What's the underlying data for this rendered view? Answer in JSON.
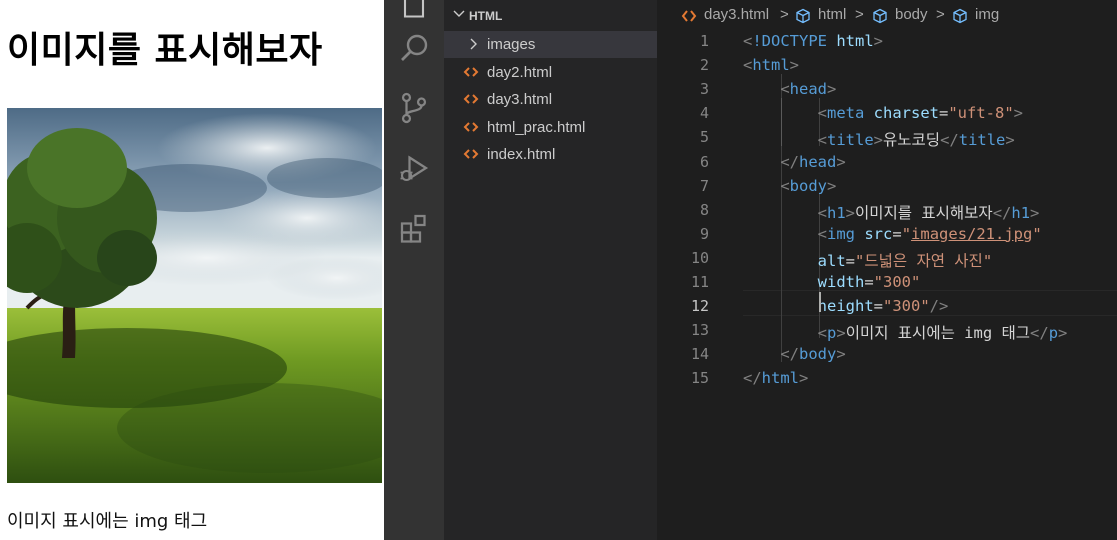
{
  "preview": {
    "heading": "이미지를 표시해보자",
    "paragraph": "이미지 표시에는 img 태그"
  },
  "explorer": {
    "folder": "HTML",
    "items": [
      {
        "label": "images",
        "type": "folder"
      },
      {
        "label": "day2.html",
        "type": "html"
      },
      {
        "label": "day3.html",
        "type": "html"
      },
      {
        "label": "html_prac.html",
        "type": "html"
      },
      {
        "label": "index.html",
        "type": "html"
      }
    ]
  },
  "breadcrumb": {
    "file": "day3.html",
    "path": [
      "html",
      "body",
      "img"
    ],
    "separator": ">"
  },
  "editor": {
    "active_line": 12,
    "line_numbers": [
      "1",
      "2",
      "3",
      "4",
      "5",
      "6",
      "7",
      "8",
      "9",
      "10",
      "11",
      "12",
      "13",
      "14",
      "15"
    ],
    "lines": [
      [
        [
          "tk-punc",
          "<"
        ],
        [
          "tk-doctype",
          "!DOCTYPE"
        ],
        [
          "tk-text",
          " "
        ],
        [
          "tk-attr",
          "html"
        ],
        [
          "tk-punc",
          ">"
        ]
      ],
      [
        [
          "tk-punc",
          "<"
        ],
        [
          "tk-tag",
          "html"
        ],
        [
          "tk-punc",
          ">"
        ]
      ],
      [
        [
          "tk-text",
          "    "
        ],
        [
          "tk-punc",
          "<"
        ],
        [
          "tk-tag",
          "head"
        ],
        [
          "tk-punc",
          ">"
        ]
      ],
      [
        [
          "tk-text",
          "        "
        ],
        [
          "tk-punc",
          "<"
        ],
        [
          "tk-tag",
          "meta"
        ],
        [
          "tk-text",
          " "
        ],
        [
          "tk-attr",
          "charset"
        ],
        [
          "tk-text",
          "="
        ],
        [
          "tk-str",
          "\"uft-8\""
        ],
        [
          "tk-punc",
          ">"
        ]
      ],
      [
        [
          "tk-text",
          "        "
        ],
        [
          "tk-punc",
          "<"
        ],
        [
          "tk-tag",
          "title"
        ],
        [
          "tk-punc",
          ">"
        ],
        [
          "tk-text",
          "유노코딩"
        ],
        [
          "tk-punc",
          "</"
        ],
        [
          "tk-tag",
          "title"
        ],
        [
          "tk-punc",
          ">"
        ]
      ],
      [
        [
          "tk-text",
          "    "
        ],
        [
          "tk-punc",
          "</"
        ],
        [
          "tk-tag",
          "head"
        ],
        [
          "tk-punc",
          ">"
        ]
      ],
      [
        [
          "tk-text",
          "    "
        ],
        [
          "tk-punc",
          "<"
        ],
        [
          "tk-tag",
          "body"
        ],
        [
          "tk-punc",
          ">"
        ]
      ],
      [
        [
          "tk-text",
          "        "
        ],
        [
          "tk-punc",
          "<"
        ],
        [
          "tk-tag",
          "h1"
        ],
        [
          "tk-punc",
          ">"
        ],
        [
          "tk-text",
          "이미지를 표시해보자"
        ],
        [
          "tk-punc",
          "</"
        ],
        [
          "tk-tag",
          "h1"
        ],
        [
          "tk-punc",
          ">"
        ]
      ],
      [
        [
          "tk-text",
          "        "
        ],
        [
          "tk-punc",
          "<"
        ],
        [
          "tk-tag",
          "img"
        ],
        [
          "tk-text",
          " "
        ],
        [
          "tk-attr",
          "src"
        ],
        [
          "tk-text",
          "="
        ],
        [
          "tk-str",
          "\""
        ],
        [
          "tk-link",
          "images/21.jpg"
        ],
        [
          "tk-str",
          "\""
        ]
      ],
      [
        [
          "tk-text",
          "        "
        ],
        [
          "tk-attr",
          "alt"
        ],
        [
          "tk-text",
          "="
        ],
        [
          "tk-str",
          "\"드넓은 자연 사진\""
        ]
      ],
      [
        [
          "tk-text",
          "        "
        ],
        [
          "tk-attr",
          "width"
        ],
        [
          "tk-text",
          "="
        ],
        [
          "tk-str",
          "\"300\""
        ]
      ],
      [
        [
          "tk-text",
          "        "
        ],
        [
          "tk-attr",
          "height"
        ],
        [
          "tk-text",
          "="
        ],
        [
          "tk-str",
          "\"300\""
        ],
        [
          "tk-punc",
          "/>"
        ]
      ],
      [
        [
          "tk-text",
          "        "
        ],
        [
          "tk-punc",
          "<"
        ],
        [
          "tk-tag",
          "p"
        ],
        [
          "tk-punc",
          ">"
        ],
        [
          "tk-text",
          "이미지 표시에는 img 태그"
        ],
        [
          "tk-punc",
          "</"
        ],
        [
          "tk-tag",
          "p"
        ],
        [
          "tk-punc",
          ">"
        ]
      ],
      [
        [
          "tk-text",
          "    "
        ],
        [
          "tk-punc",
          "</"
        ],
        [
          "tk-tag",
          "body"
        ],
        [
          "tk-punc",
          ">"
        ]
      ],
      [
        [
          "tk-punc",
          "</"
        ],
        [
          "tk-tag",
          "html"
        ],
        [
          "tk-punc",
          ">"
        ]
      ]
    ]
  },
  "activity_bar": [
    "explorer-icon",
    "search-icon",
    "source-control-icon",
    "run-debug-icon",
    "extensions-icon"
  ],
  "colors": {
    "html_file_icon": "#e37933",
    "accent": "#4a78d6",
    "tag": "#569cd6",
    "attribute": "#9cdcfe",
    "string": "#ce9178"
  }
}
